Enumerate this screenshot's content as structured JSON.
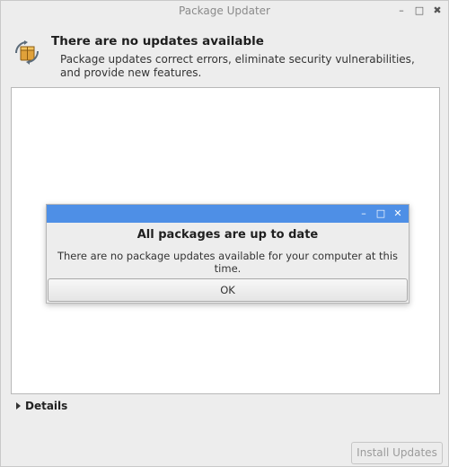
{
  "window": {
    "title": "Package Updater",
    "controls": {
      "minimize": "–",
      "maximize": "□",
      "close": "✖"
    }
  },
  "header": {
    "icon": "package-updater-icon",
    "title": "There are no updates available",
    "description": "Package updates correct errors, eliminate security vulnerabilities, and provide new features."
  },
  "details": {
    "label": "Details",
    "expanded": false
  },
  "footer": {
    "install_label": "Install Updates",
    "install_enabled": false
  },
  "dialog": {
    "titlebar_color": "#4e8fe6",
    "controls": {
      "minimize": "–",
      "maximize": "□",
      "close": "✕"
    },
    "title": "All packages are up to date",
    "message": "There are no package updates available for your computer at this time.",
    "ok_label": "OK"
  }
}
